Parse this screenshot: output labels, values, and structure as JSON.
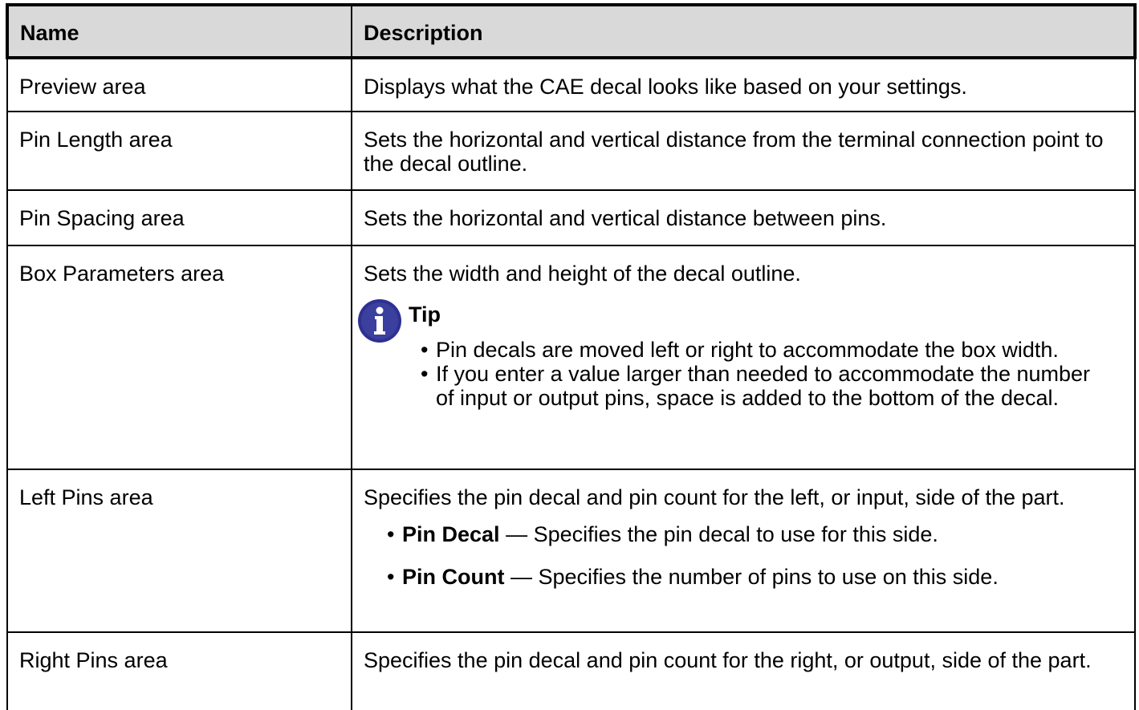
{
  "table": {
    "headers": {
      "name": "Name",
      "description": "Description"
    },
    "rows": [
      {
        "name": "Preview area",
        "description": "Displays what the CAE decal looks like based on your settings."
      },
      {
        "name": "Pin Length area",
        "description": "Sets the horizontal and vertical distance from the terminal connection point to the decal outline."
      },
      {
        "name": "Pin Spacing area",
        "description": "Sets the horizontal and vertical distance between pins."
      },
      {
        "name": "Box Parameters area",
        "description": "Sets the width and height of the decal outline.",
        "tip": {
          "title": "Tip",
          "icon": "info-icon",
          "items": [
            "Pin decals are moved left or right to accommodate the box width.",
            "If you enter a value larger than needed to accommodate the number of input or output pins, space is added to the bottom of the decal."
          ]
        }
      },
      {
        "name": "Left Pins area",
        "description": "Specifies the pin decal and pin count for the left, or input, side of the part.",
        "items": [
          {
            "term": "Pin Decal",
            "separator": " — ",
            "text": "Specifies the pin decal to use for this side."
          },
          {
            "term": "Pin Count",
            "separator": " — ",
            "text": "Specifies the number of pins to use on this side."
          }
        ]
      },
      {
        "name": "Right Pins area",
        "description": "Specifies the pin decal and pin count for the right, or output, side of the part."
      }
    ]
  },
  "colors": {
    "header_bg": "#d9d9d9",
    "border": "#000000",
    "info_icon": "#3b3f9e"
  }
}
